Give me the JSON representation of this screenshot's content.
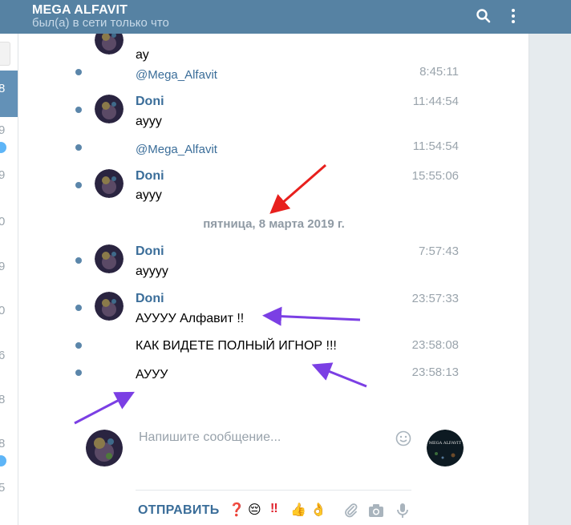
{
  "header": {
    "title": "MEGA ALFAVIT",
    "status": "был(а) в сети только что"
  },
  "sidebar_stub": {
    "active_time": "8",
    "times": [
      "9",
      "9",
      "0",
      "9",
      "0",
      "6",
      "8",
      "8",
      "5"
    ]
  },
  "messages": [
    {
      "text": "ау"
    },
    {
      "forward_from": "@Mega_Alfavit",
      "time": "8:45:11"
    },
    {
      "author": "Doni",
      "time": "11:44:54",
      "text": "ayyy"
    },
    {
      "forward_from": "@Mega_Alfavit",
      "time": "11:54:54"
    },
    {
      "author": "Doni",
      "time": "15:55:06",
      "text": "ayyy"
    },
    {
      "author": "Doni",
      "time": "7:57:43",
      "text": "ayyyy"
    },
    {
      "author": "Doni",
      "time": "23:57:33",
      "text": "АУУУУ Алфавит !!"
    },
    {
      "time": "23:58:08",
      "text": "КАК ВИДЕТЕ ПОЛНЫЙ ИГНОР  !!!"
    },
    {
      "time": "23:58:13",
      "text": "АУУУ"
    }
  ],
  "day_separator": "пятница, 8 марта 2019 г.",
  "composer": {
    "placeholder": "Напишите сообщение...",
    "send_label": "ОТПРАВИТЬ",
    "peer_avatar_text": "MEGA ALFAVIT",
    "quick_emoji": [
      "❓",
      "😔",
      "‼",
      "👍",
      "👌"
    ]
  },
  "colors": {
    "header_bg": "#5682a3",
    "accent": "#3a6d99",
    "arrow_red": "#e8201d",
    "arrow_purple": "#7b3fe4"
  },
  "icons": [
    "search-icon",
    "more-vertical-icon",
    "smile-icon",
    "paperclip-icon",
    "camera-icon",
    "microphone-icon"
  ]
}
